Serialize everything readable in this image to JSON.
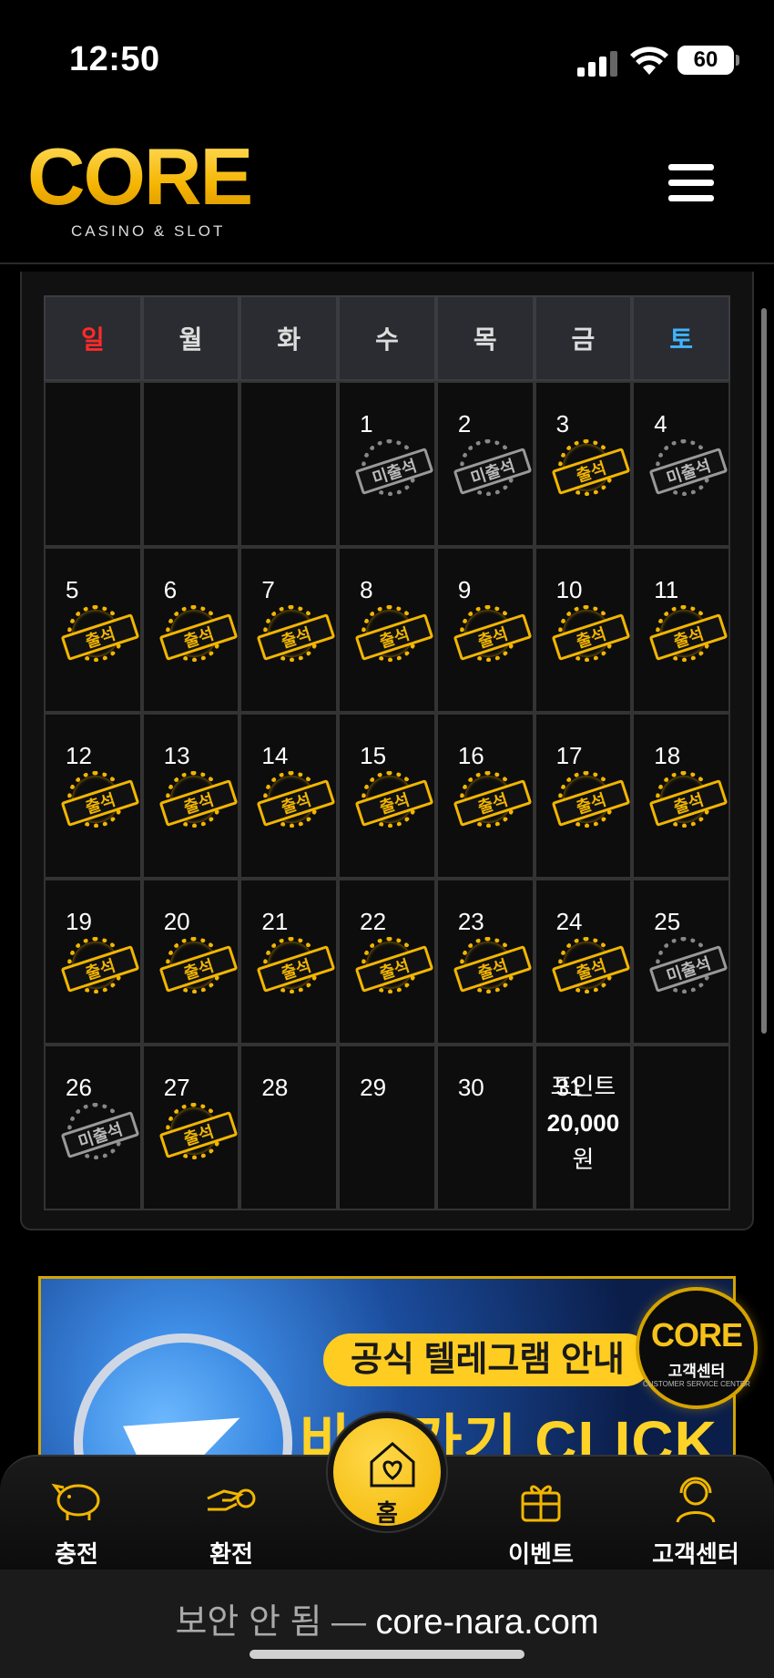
{
  "status": {
    "time": "12:50",
    "battery": "60"
  },
  "header": {
    "brand": "CORE",
    "tagline": "CASINO & SLOT",
    "menu_icon": "hamburger-icon"
  },
  "calendar": {
    "weekdays": [
      "일",
      "월",
      "화",
      "수",
      "목",
      "금",
      "토"
    ],
    "weeks": [
      [
        {
          "day": "",
          "stamp": ""
        },
        {
          "day": "",
          "stamp": ""
        },
        {
          "day": "",
          "stamp": ""
        },
        {
          "day": "1",
          "stamp": "미출석"
        },
        {
          "day": "2",
          "stamp": "미출석"
        },
        {
          "day": "3",
          "stamp": "출석"
        },
        {
          "day": "4",
          "stamp": "미출석"
        }
      ],
      [
        {
          "day": "5",
          "stamp": "출석"
        },
        {
          "day": "6",
          "stamp": "출석"
        },
        {
          "day": "7",
          "stamp": "출석"
        },
        {
          "day": "8",
          "stamp": "출석"
        },
        {
          "day": "9",
          "stamp": "출석"
        },
        {
          "day": "10",
          "stamp": "출석"
        },
        {
          "day": "11",
          "stamp": "출석"
        }
      ],
      [
        {
          "day": "12",
          "stamp": "출석"
        },
        {
          "day": "13",
          "stamp": "출석"
        },
        {
          "day": "14",
          "stamp": "출석"
        },
        {
          "day": "15",
          "stamp": "출석"
        },
        {
          "day": "16",
          "stamp": "출석"
        },
        {
          "day": "17",
          "stamp": "출석"
        },
        {
          "day": "18",
          "stamp": "출석"
        }
      ],
      [
        {
          "day": "19",
          "stamp": "출석"
        },
        {
          "day": "20",
          "stamp": "출석"
        },
        {
          "day": "21",
          "stamp": "출석"
        },
        {
          "day": "22",
          "stamp": "출석"
        },
        {
          "day": "23",
          "stamp": "출석"
        },
        {
          "day": "24",
          "stamp": "출석"
        },
        {
          "day": "25",
          "stamp": "미출석"
        }
      ],
      [
        {
          "day": "26",
          "stamp": "미출석"
        },
        {
          "day": "27",
          "stamp": "출석"
        },
        {
          "day": "28",
          "stamp": ""
        },
        {
          "day": "29",
          "stamp": ""
        },
        {
          "day": "30",
          "stamp": ""
        },
        {
          "day": "31",
          "stamp": "",
          "reward": [
            "포인트",
            "20,000",
            "원"
          ]
        },
        {
          "day": "",
          "stamp": ""
        }
      ]
    ]
  },
  "banner": {
    "line1": "공식 텔레그램 안내",
    "line2": "바로가기 CLICK"
  },
  "cs_badge": {
    "brand": "CORE",
    "title": "고객센터",
    "subtitle": "CUSTOMER SERVICE CENTER"
  },
  "nav": {
    "charge": "충전",
    "exchange": "환전",
    "home": "홈",
    "event": "이벤트",
    "support": "고객센터"
  },
  "urlbar": {
    "insecure": "보안 안 됨 —",
    "domain": "core-nara.com"
  },
  "colors": {
    "gold": "#f2b600",
    "sunday": "#ff2a2a",
    "saturday": "#3fb5ff"
  }
}
